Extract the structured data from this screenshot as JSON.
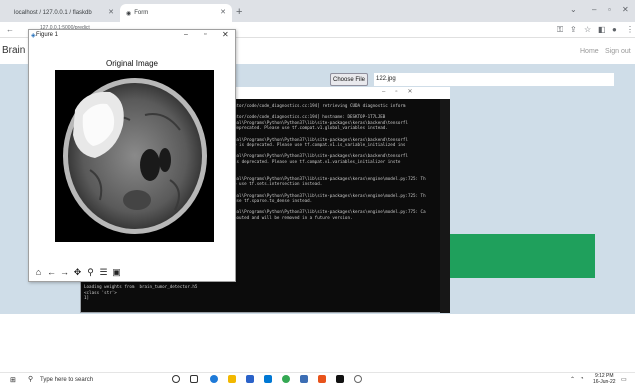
{
  "browser": {
    "tabs": [
      {
        "label": "localhost / 127.0.0.1 / flaskdb"
      },
      {
        "label": "Form"
      }
    ],
    "url": "127.0.0.1:5000/predict"
  },
  "site": {
    "brand": "Brain",
    "nav": {
      "home": "Home",
      "signout": "Sign out"
    },
    "upload": {
      "button_label": "Choose File",
      "file_name": "122.jpg"
    }
  },
  "figure_window": {
    "title": "Figure 1",
    "heading": "Original Image",
    "toolbar_icons": [
      "home-icon",
      "back-icon",
      "forward-icon",
      "pan-icon",
      "zoom-icon",
      "configure-icon",
      "save-icon"
    ]
  },
  "console": {
    "lines_right": [
      "ntor/code/code_diagnostics.cc:194] retrieving CUDA diagnostic inform",
      "",
      "ntor/code/code_diagnostics.cc:194] hostname: DESKTOP-1T7LJEB",
      "eal\\Programs\\Python\\Python37\\lib\\site-packages\\keras\\backend\\tensorfl",
      "deprecated. Please use tf.compat.v1.global_variables instead.",
      "",
      "eal\\Programs\\Python\\Python37\\lib\\site-packages\\keras\\backend\\tensorfl",
      "e is deprecated. Please use tf.compat.v1.is_variable_initialized ins",
      "",
      "eal\\Programs\\Python\\Python37\\lib\\site-packages\\keras\\backend\\tensorfl",
      "is deprecated. Please use tf.compat.v1.variables_initializer inste",
      "",
      "",
      "eal\\Programs\\Python\\Python37\\lib\\site-packages\\keras\\engine\\model.py:725: Th",
      "e use tf.sets.intersection instead.",
      "",
      "eal\\Programs\\Python\\Python37\\lib\\site-packages\\keras\\engine\\model.py:725: Th",
      "use tf.sparse.to_dense instead.",
      "",
      "eal\\Programs\\Python\\Python37\\lib\\site-packages\\keras\\engine\\model.py:775: Ca",
      "nouted and will be removed in a future version."
    ],
    "lines_bottom": [
      "Loading weights from  brain_tumor_detector.h5",
      "<class 'str'>",
      "1]"
    ]
  },
  "taskbar": {
    "search_placeholder": "Type here to search",
    "time": "9:12 PM",
    "date": "16-Jun-22"
  },
  "colors": {
    "hero_bg": "#cfdde8",
    "green_button": "#1fa05c",
    "console_bg": "#0c0c0c"
  }
}
